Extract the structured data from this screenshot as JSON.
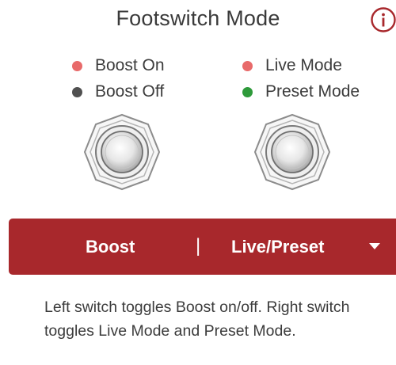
{
  "header": {
    "title": "Footswitch Mode"
  },
  "legend": {
    "left": [
      {
        "label": "Boost On",
        "color": "#e86a6a"
      },
      {
        "label": "Boost Off",
        "color": "#505050"
      }
    ],
    "right": [
      {
        "label": "Live Mode",
        "color": "#e86a6a"
      },
      {
        "label": "Preset Mode",
        "color": "#2e9a3a"
      }
    ]
  },
  "mode_selector": {
    "left_label": "Boost",
    "separator": "|",
    "right_label": "Live/Preset",
    "background_color": "#a8282c"
  },
  "description": "Left switch toggles Boost on/off. Right switch toggles Live Mode and Preset Mode.",
  "icons": {
    "info": "info-icon",
    "caret": "caret-down-icon",
    "footswitch": "footswitch-icon"
  },
  "colors": {
    "accent": "#a8282c",
    "info_icon": "#a8282c"
  }
}
